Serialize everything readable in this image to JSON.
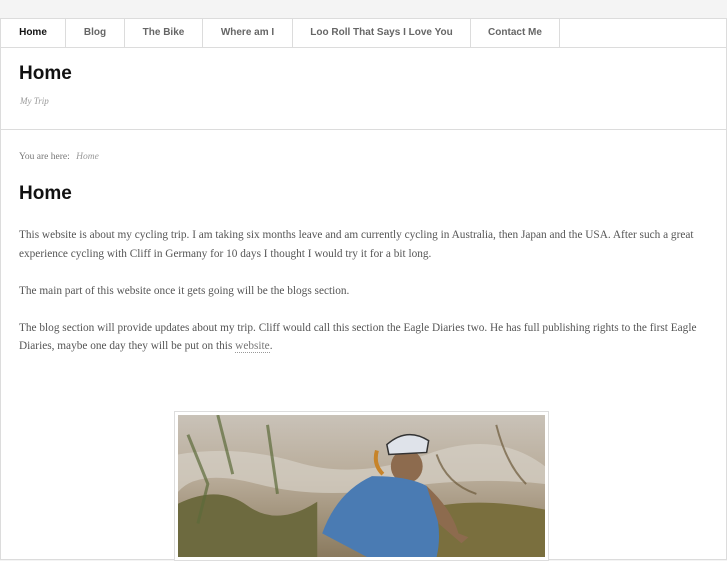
{
  "nav": {
    "items": [
      {
        "label": "Home",
        "active": true
      },
      {
        "label": "Blog",
        "active": false
      },
      {
        "label": "The Bike",
        "active": false
      },
      {
        "label": "Where am I",
        "active": false
      },
      {
        "label": "Loo Roll That Says I Love You",
        "active": false
      },
      {
        "label": "Contact Me",
        "active": false
      }
    ]
  },
  "header": {
    "site_title": "Home",
    "tagline": "My Trip"
  },
  "breadcrumb": {
    "prefix": "You are here:",
    "current": "Home"
  },
  "main": {
    "heading": "Home",
    "p1": "This website is about my cycling trip. I am taking six months leave and am currently  cycling in Australia, then Japan and the USA. After such a great experience cycling with Cliff in Germany for 10 days I thought I would try it for a bit long.",
    "p2": "The main part of this website once it gets going will be the blogs section.",
    "p3_before": "The blog section will provide updates about my trip. Cliff would call this section the Eagle Diaries two. He has full publishing rights to the first Eagle Diaries, maybe one day they will be put on this ",
    "p3_link": "website",
    "p3_after": "."
  },
  "colors": {
    "accent_text": "#111111",
    "link": "#777777",
    "border": "#dcdcdc"
  }
}
